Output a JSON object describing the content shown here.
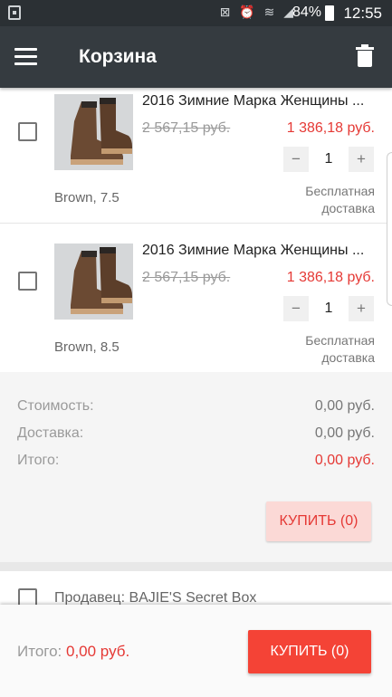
{
  "status_bar": {
    "battery": "84%",
    "time": "12:55",
    "icons": "⊠ ⏰ ≋ ◢"
  },
  "header": {
    "title": "Корзина"
  },
  "items": [
    {
      "title": "2016 Зимние Марка Женщины ...",
      "old_price": "2 567,15 руб.",
      "new_price": "1 386,18 руб.",
      "quantity": "1",
      "minus": "−",
      "plus": "+",
      "variant": "Brown, 7.5",
      "shipping_line1": "Бесплатная",
      "shipping_line2": "доставка"
    },
    {
      "title": "2016 Зимние Марка Женщины ...",
      "old_price": "2 567,15 руб.",
      "new_price": "1 386,18 руб.",
      "quantity": "1",
      "minus": "−",
      "plus": "+",
      "variant": "Brown, 8.5",
      "shipping_line1": "Бесплатная",
      "shipping_line2": "доставка"
    }
  ],
  "summary": {
    "cost_label": "Стоимость:",
    "cost_value": "0,00 руб.",
    "delivery_label": "Доставка:",
    "delivery_value": "0,00 руб.",
    "total_label": "Итого:",
    "total_value": "0,00 руб.",
    "buy_label": "КУПИТЬ (0)"
  },
  "seller": {
    "label": "Продавец:  BAJIE'S Secret Box"
  },
  "bottom": {
    "total_label": "Итого: ",
    "total_value": "0,00 руб.",
    "buy_label": "КУПИТЬ (0)"
  },
  "colors": {
    "accent": "#f44336",
    "price_red": "#e53935",
    "appbar": "#353b40"
  }
}
